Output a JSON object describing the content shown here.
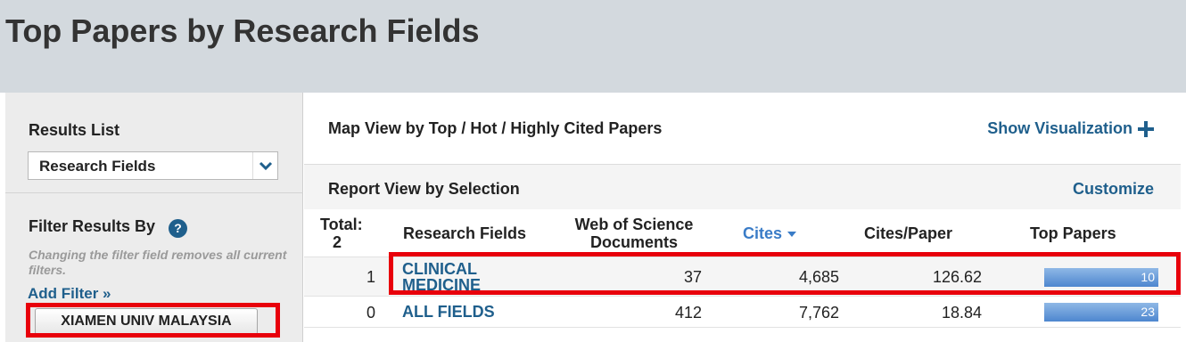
{
  "page_title": "Top Papers by Research Fields",
  "sidebar": {
    "results_label": "Results List",
    "select_value": "Research Fields",
    "filter_label": "Filter Results By",
    "filter_note": "Changing the filter field removes all current filters.",
    "add_filter": "Add Filter »",
    "filter_chip": "XIAMEN UNIV MALAYSIA"
  },
  "main": {
    "map_label": "Map View by Top / Hot / Highly Cited Papers",
    "show_visualization": "Show Visualization",
    "report_label": "Report View by Selection",
    "customize": "Customize"
  },
  "table": {
    "headers": {
      "total": "Total:",
      "total_count": "2",
      "research_fields": "Research Fields",
      "wos_line1": "Web of Science",
      "wos_line2": "Documents",
      "cites": "Cites",
      "cites_per_paper": "Cites/Paper",
      "top_papers": "Top Papers"
    },
    "rows": [
      {
        "index": "1",
        "field_line1": "CLINICAL",
        "field_line2": "MEDICINE",
        "wos_documents": "37",
        "cites": "4,685",
        "cites_per_paper": "126.62",
        "top_papers": "10",
        "top_papers_fraction": 1.0
      },
      {
        "index": "0",
        "field_line1": "ALL FIELDS",
        "wos_documents": "412",
        "cites": "7,762",
        "cites_per_paper": "18.84",
        "top_papers": "23",
        "top_papers_fraction": 1.0
      }
    ]
  },
  "colors": {
    "link": "#1f5f8c",
    "highlight_box": "#e8000b",
    "bar": "#4d86cf"
  }
}
